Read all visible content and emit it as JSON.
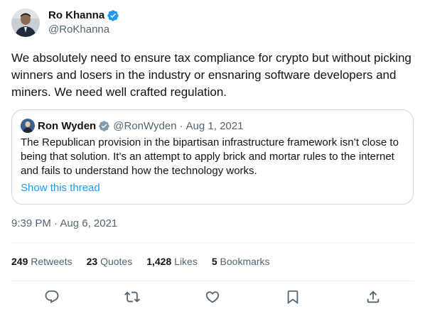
{
  "author": {
    "name": "Ro Khanna",
    "handle": "@RoKhanna"
  },
  "tweet": {
    "text": "We absolutely need to ensure tax compliance for crypto but without picking winners and losers in the industry or ensnaring software developers and miners. We need well crafted regulation.",
    "timestamp": "9:39 PM · Aug 6, 2021"
  },
  "quoted": {
    "name": "Ron Wyden",
    "handle": "@RonWyden",
    "separator": "·",
    "date": "Aug 1, 2021",
    "text": "The Republican provision in the bipartisan infrastructure framework isn’t close to being that solution. It’s an attempt to apply brick and mortar rules to the internet and fails to understand how the technology works.",
    "link": "Show this thread"
  },
  "stats": {
    "retweets_count": "249",
    "retweets_label": "Retweets",
    "quotes_count": "23",
    "quotes_label": "Quotes",
    "likes_count": "1,428",
    "likes_label": "Likes",
    "bookmarks_count": "5",
    "bookmarks_label": "Bookmarks"
  },
  "icons": {
    "verified": "verified-badge-icon",
    "reply": "reply-icon",
    "retweet": "retweet-icon",
    "like": "heart-icon",
    "bookmark": "bookmark-icon",
    "share": "share-icon"
  },
  "colors": {
    "accent": "#1d9bf0",
    "text": "#0f1419",
    "secondary": "#536471",
    "border": "#cfd9de",
    "quote_verified": "#829aab"
  }
}
